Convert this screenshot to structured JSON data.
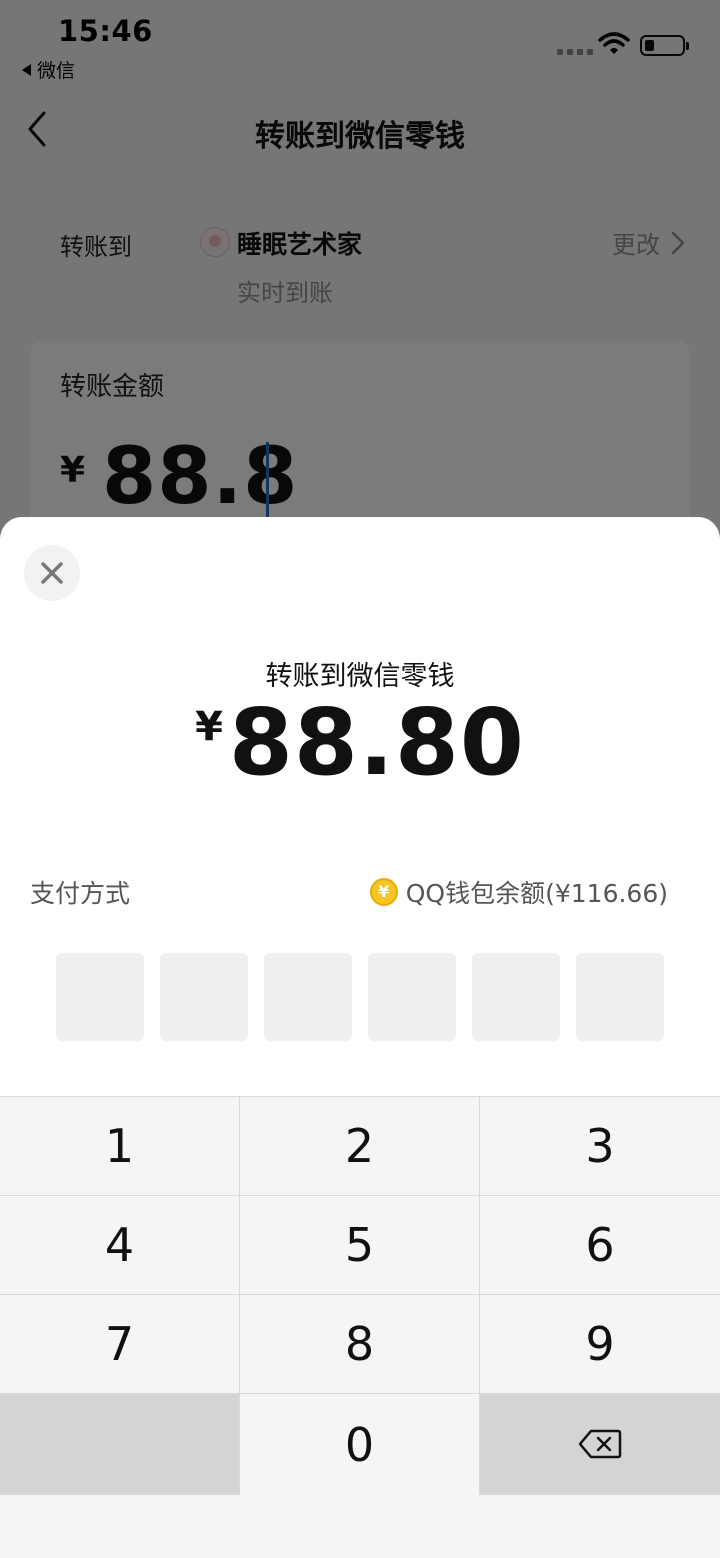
{
  "status_bar": {
    "time": "15:46",
    "back_app": "微信"
  },
  "nav": {
    "title": "转账到微信零钱"
  },
  "recipient": {
    "label": "转账到",
    "name": "睡眠艺术家",
    "subtitle": "实时到账",
    "change": "更改"
  },
  "amount_input": {
    "label": "转账金额",
    "currency": "¥",
    "value": "88.8"
  },
  "sheet": {
    "title": "转账到微信零钱",
    "currency": "¥",
    "amount": "88.80",
    "payment_method_label": "支付方式",
    "payment_method_value": "QQ钱包余额(¥116.66)"
  },
  "keypad": {
    "keys": [
      "1",
      "2",
      "3",
      "4",
      "5",
      "6",
      "7",
      "8",
      "9",
      "0"
    ]
  },
  "colors": {
    "cursor": "#1f6fc1",
    "coin": "#f6c624"
  }
}
